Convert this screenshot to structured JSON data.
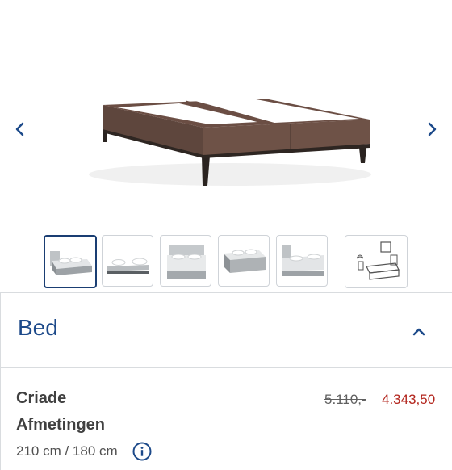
{
  "gallery": {
    "prev_icon": "chevron-left-icon",
    "next_icon": "chevron-right-icon",
    "accent_color": "#1d4a8a",
    "main_image": "boxspring-base-brown",
    "thumbnails": [
      {
        "name": "bed-angle-view",
        "active": true
      },
      {
        "name": "bed-flat-view",
        "active": false
      },
      {
        "name": "bed-front-view",
        "active": false
      },
      {
        "name": "bed-side-view",
        "active": false
      },
      {
        "name": "bed-headboard-view",
        "active": false
      },
      {
        "name": "room-sketch-view",
        "active": false
      }
    ]
  },
  "section": {
    "title": "Bed",
    "toggle_icon": "chevron-up-icon"
  },
  "product": {
    "name": "Criade",
    "old_price": "5.110,-",
    "new_price": "4.343,50",
    "price_color": "#b3261e",
    "dimensions_label": "Afmetingen",
    "dimensions_value": "210 cm / 180 cm",
    "info_icon": "info-icon"
  }
}
